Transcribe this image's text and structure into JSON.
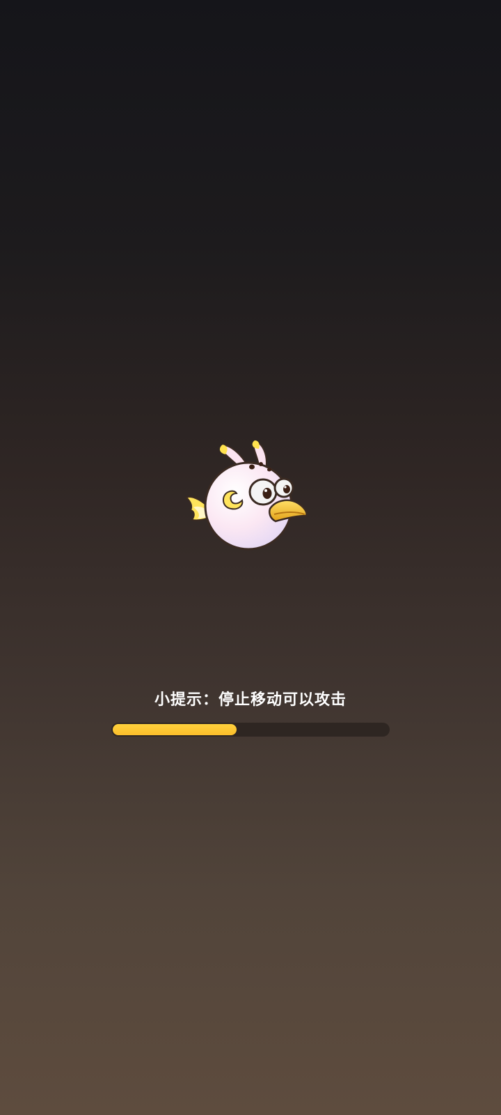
{
  "loading": {
    "tip": "小提示：停止移动可以攻击",
    "progress_percent": 45
  },
  "mascot": {
    "icon": "white-bird-character-icon"
  },
  "colors": {
    "progress_fill": "#fbbd2b",
    "progress_track": "#2e2622",
    "background_top": "#15151a",
    "background_bottom": "#5e4c3e"
  }
}
